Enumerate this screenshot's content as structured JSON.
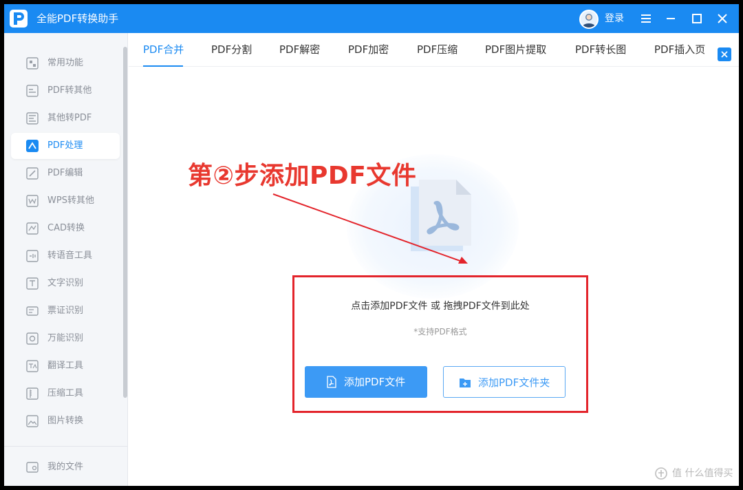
{
  "app": {
    "title": "全能PDF转换助手",
    "login": "登录"
  },
  "window_controls": [
    "menu-icon",
    "minimize-icon",
    "maximize-icon",
    "close-icon"
  ],
  "sidebar": {
    "items": [
      {
        "label": "常用功能",
        "icon": "grid-icon"
      },
      {
        "label": "PDF转其他",
        "icon": "pdf-export-icon"
      },
      {
        "label": "其他转PDF",
        "icon": "pdf-import-icon"
      },
      {
        "label": "PDF处理",
        "icon": "pdf-process-icon",
        "active": true
      },
      {
        "label": "PDF编辑",
        "icon": "pdf-edit-icon"
      },
      {
        "label": "WPS转其他",
        "icon": "wps-icon"
      },
      {
        "label": "CAD转换",
        "icon": "cad-icon"
      },
      {
        "label": "转语音工具",
        "icon": "text-to-speech-icon"
      },
      {
        "label": "文字识别",
        "icon": "ocr-icon"
      },
      {
        "label": "票证识别",
        "icon": "ticket-icon"
      },
      {
        "label": "万能识别",
        "icon": "universal-recognition-icon"
      },
      {
        "label": "翻译工具",
        "icon": "translate-icon"
      },
      {
        "label": "压缩工具",
        "icon": "compress-icon"
      },
      {
        "label": "图片转换",
        "icon": "image-convert-icon"
      }
    ],
    "footer": {
      "label": "我的文件",
      "icon": "my-files-icon"
    }
  },
  "tabs": [
    {
      "label": "PDF合并",
      "active": true
    },
    {
      "label": "PDF分割"
    },
    {
      "label": "PDF解密"
    },
    {
      "label": "PDF加密"
    },
    {
      "label": "PDF压缩"
    },
    {
      "label": "PDF图片提取"
    },
    {
      "label": "PDF转长图"
    },
    {
      "label": "PDF插入页"
    }
  ],
  "main": {
    "annotation": "第②步添加PDF文件",
    "hint": "点击添加PDF文件 或 拖拽PDF文件到此处",
    "sub_hint": "*支持PDF格式",
    "add_file_button": "添加PDF文件",
    "add_folder_button": "添加PDF文件夹"
  },
  "watermark": "值 什么值得买",
  "colors": {
    "brand_blue": "#1a8af2",
    "button_blue": "#3c9af5",
    "annotation_red": "#e8382f",
    "highlight_red": "#e3242b"
  }
}
